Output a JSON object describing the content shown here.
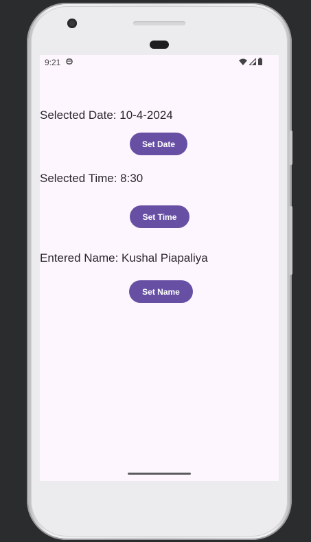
{
  "status_bar": {
    "time": "9:21",
    "notification_icon": "android-debug-icon",
    "right_icons": [
      "wifi-icon",
      "signal-icon",
      "battery-icon"
    ]
  },
  "main": {
    "date_text": "Selected Date: 10-4-2024",
    "set_date_label": "Set Date",
    "time_text": "Selected Time: 8:30",
    "set_time_label": "Set Time",
    "name_text": "Entered Name: Kushal Piapaliya",
    "set_name_label": "Set Name"
  },
  "colors": {
    "accent": "#6750a4",
    "screen_bg": "#fdf6fe",
    "text": "#2a272c"
  }
}
